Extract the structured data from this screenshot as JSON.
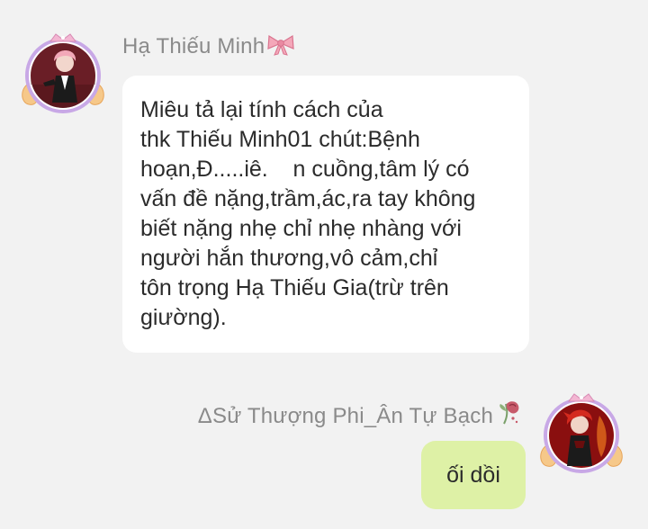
{
  "messages": [
    {
      "sender": "Hạ Thiếu Minh",
      "sender_emoji": "ribbon-icon",
      "direction": "incoming",
      "text": "Miêu tả lại tính cách của\nthk Thiếu Minh01 chút:Bệnh\nhoạn,Đ.....iê.    n cuồng,tâm lý có\nvấn đề nặng,trầm,ác,ra tay không\nbiết nặng nhẹ chỉ nhẹ nhàng với\nngười hắn thương,vô cảm,chỉ\ntôn trọng Hạ Thiếu Gia(trừ trên\ngiường)."
    },
    {
      "sender": "ΔSử Thượng Phi_Ân Tự Bạch",
      "sender_emoji": "wilted-rose-icon",
      "direction": "outgoing",
      "text": "ối dồi"
    }
  ],
  "colors": {
    "background": "#f2f2f2",
    "incoming_bubble": "#ffffff",
    "outgoing_bubble": "#def1a6",
    "name_text": "#8a8a8a",
    "message_text": "#2b2b2b"
  }
}
